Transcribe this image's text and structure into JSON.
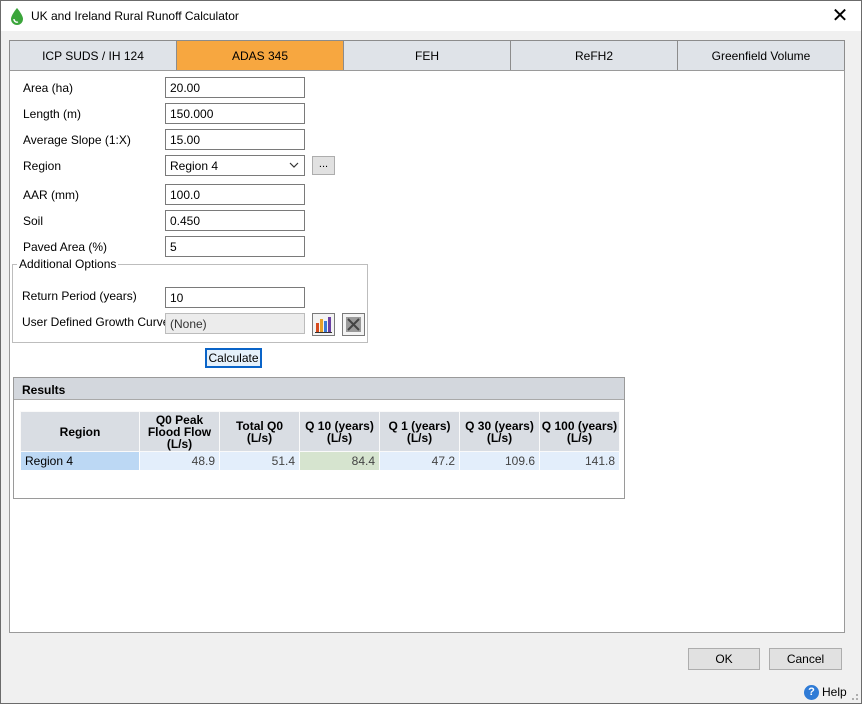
{
  "window": {
    "title": "UK and Ireland Rural Runoff Calculator",
    "close_glyph": "✕"
  },
  "tabs": [
    {
      "label": "ICP SUDS / IH 124",
      "active": false
    },
    {
      "label": "ADAS 345",
      "active": true
    },
    {
      "label": "FEH",
      "active": false
    },
    {
      "label": "ReFH2",
      "active": false
    },
    {
      "label": "Greenfield Volume",
      "active": false
    }
  ],
  "form": {
    "area": {
      "label": "Area (ha)",
      "value": "20.00"
    },
    "length": {
      "label": "Length (m)",
      "value": "150.000"
    },
    "slope": {
      "label": "Average Slope (1:X)",
      "value": "15.00"
    },
    "region": {
      "label": "Region",
      "value": "Region 4",
      "browse_label": "..."
    },
    "aar": {
      "label": "AAR (mm)",
      "value": "100.0"
    },
    "soil": {
      "label": "Soil",
      "value": "0.450"
    },
    "paved": {
      "label": "Paved Area (%)",
      "value": "5"
    }
  },
  "options": {
    "title": "Additional Options",
    "return_period": {
      "label": "Return Period (years)",
      "value": "10"
    },
    "growth_curve": {
      "label": "User Defined Growth Curve",
      "value": "(None)"
    }
  },
  "calculate_label": "Calculate",
  "results": {
    "title": "Results",
    "columns": [
      [
        "Region"
      ],
      [
        "Q0 Peak",
        "Flood Flow",
        "(L/s)"
      ],
      [
        "Total Q0",
        "(L/s)"
      ],
      [
        "Q 10 (years)",
        "(L/s)"
      ],
      [
        "Q 1 (years)",
        "(L/s)"
      ],
      [
        "Q 30 (years)",
        "(L/s)"
      ],
      [
        "Q 100 (years)",
        "(L/s)"
      ]
    ],
    "rows": [
      [
        "Region 4",
        "48.9",
        "51.4",
        "84.4",
        "47.2",
        "109.6",
        "141.8"
      ]
    ]
  },
  "footer": {
    "ok_label": "OK",
    "cancel_label": "Cancel",
    "help_label": "Help"
  },
  "colors": {
    "active_tab": "#f7a740",
    "tab": "#dfe3e8",
    "selection": "#bcd8f4",
    "highlight_cell": "#d6e4cf"
  }
}
